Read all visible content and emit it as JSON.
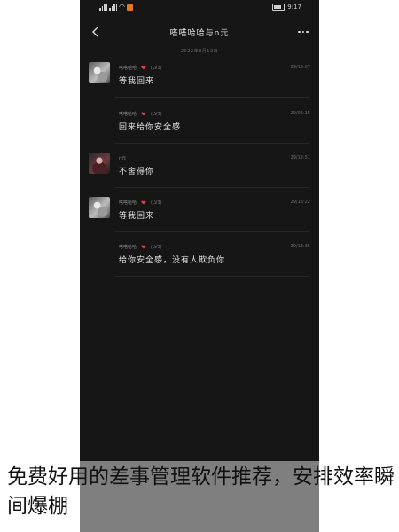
{
  "status_bar": {
    "time": "9:17",
    "battery_level": 0.8
  },
  "header": {
    "title": "嗒嗒哈哈与n元"
  },
  "date_divider": "2022年8月12日",
  "messages": [
    {
      "sender": "嗒嗒哈哈",
      "level": "(LV3)",
      "time": "29/13:07",
      "text": "等我回来",
      "avatar": "gray"
    },
    {
      "sender": "嗒嗒哈哈",
      "level": "(LV3)",
      "time": "29/06:15",
      "text": "回来给你安全感",
      "avatar": "none"
    },
    {
      "sender": "n元",
      "level": "",
      "time": "29/12:51",
      "text": "不舍得你",
      "avatar": "dark"
    },
    {
      "sender": "嗒嗒哈哈",
      "level": "(LV3)",
      "time": "29/13:22",
      "text": "等我回来",
      "avatar": "gray"
    },
    {
      "sender": "嗒嗒哈哈",
      "level": "(LV3)",
      "time": "29/13:35",
      "text": "给你安全感，没有人欺负你",
      "avatar": "none"
    }
  ],
  "caption": "免费好用的差事管理软件推荐，安排效率瞬间爆棚",
  "icons": {
    "back": "chevron-left-icon",
    "more": "more-dots-icon",
    "heart": "heart-icon"
  },
  "colors": {
    "background": "#161616",
    "heart": "#e0434f",
    "text": "#e6e6e6"
  }
}
